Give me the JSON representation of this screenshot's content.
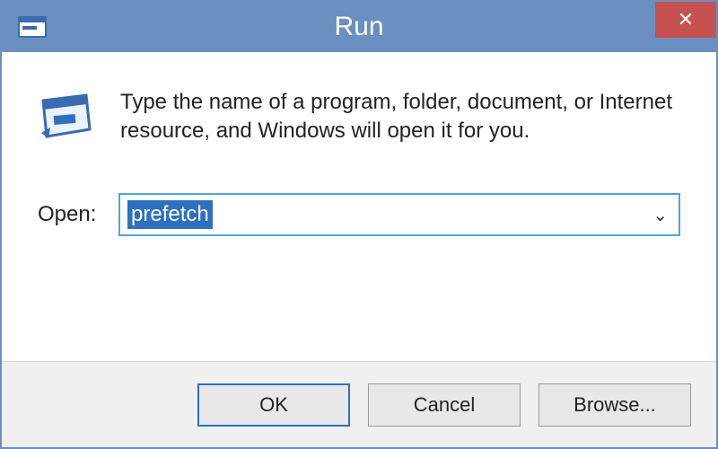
{
  "titlebar": {
    "title": "Run",
    "close_label": "✕"
  },
  "body": {
    "description": "Type the name of a program, folder, document, or Internet resource, and Windows will open it for you.",
    "open_label": "Open:",
    "input_value": "prefetch"
  },
  "buttons": {
    "ok": "OK",
    "cancel": "Cancel",
    "browse": "Browse..."
  }
}
